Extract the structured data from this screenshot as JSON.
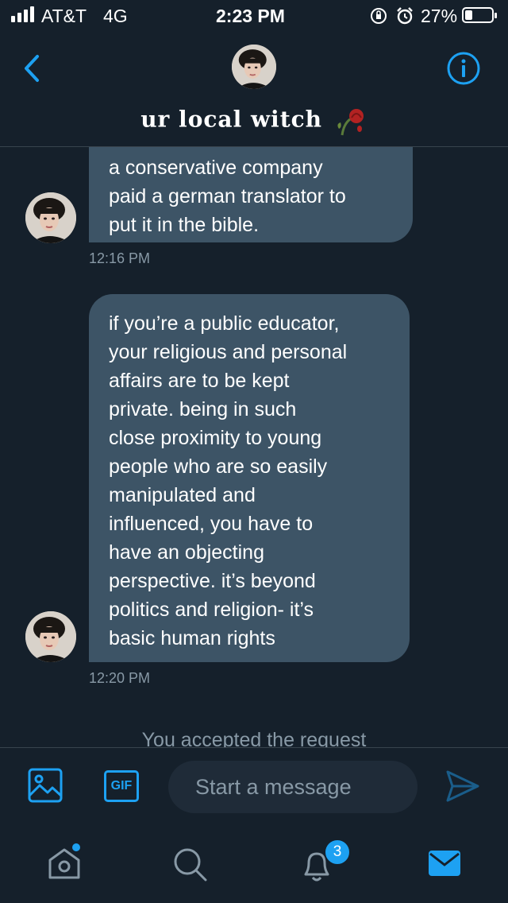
{
  "status_bar": {
    "carrier": "AT&T",
    "network": "4G",
    "time": "2:23 PM",
    "battery": "27%"
  },
  "header": {
    "back_icon": "chevron-left-icon",
    "info_icon": "info-icon",
    "name": "ur local witch",
    "name_emoji_icon": "wilted-rose-icon"
  },
  "messages": [
    {
      "lines": [
        "a conservative company",
        "paid a german translator to",
        "put it in the bible."
      ],
      "time": "12:16 PM"
    },
    {
      "lines": [
        "if you’re a public educator,",
        "your religious and personal",
        "affairs are to be kept",
        "private. being in such",
        "close proximity to young",
        "people who are so easily",
        "manipulated and",
        "influenced, you have to",
        "have an objecting",
        "perspective. it’s beyond",
        "politics and religion- it’s",
        "basic human rights"
      ],
      "time": "12:20 PM"
    }
  ],
  "system_notice": "You accepted the request",
  "composer": {
    "placeholder": "Start a message",
    "gif_label": "GIF"
  },
  "tabbar": {
    "notifications_count": "3"
  },
  "colors": {
    "background": "#15202b",
    "bubble": "#3d5466",
    "accent": "#1da1f2",
    "muted": "#8899a6"
  }
}
